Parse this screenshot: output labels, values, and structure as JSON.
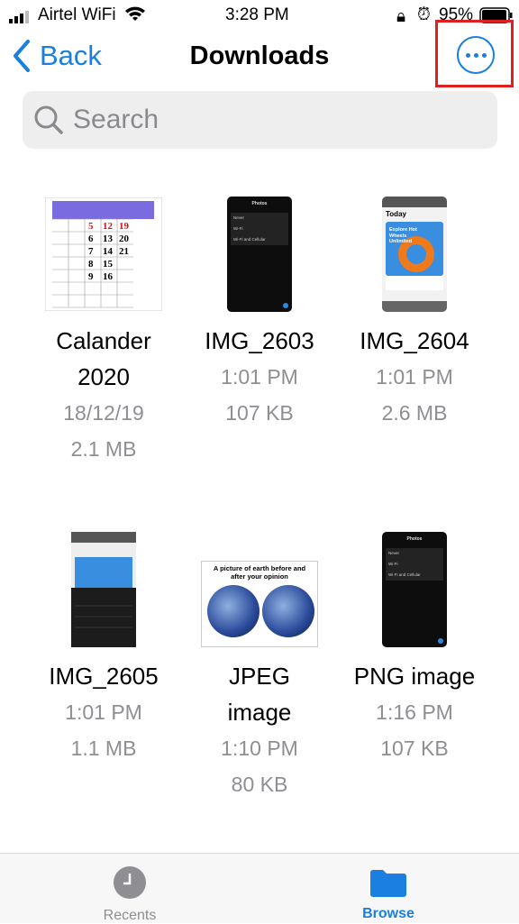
{
  "status": {
    "carrier": "Airtel WiFi",
    "time": "3:28 PM",
    "battery": "95%"
  },
  "nav": {
    "back": "Back",
    "title": "Downloads",
    "more_icon": "ellipsis-circle-icon"
  },
  "search": {
    "placeholder": "Search"
  },
  "files": [
    {
      "name1": "Calander",
      "name2": "2020",
      "meta1": "18/12/19",
      "meta2": "2.1 MB",
      "thumb": "calendar"
    },
    {
      "name1": "IMG_2603",
      "name2": "",
      "meta1": "1:01 PM",
      "meta2": "107 KB",
      "thumb": "dark-phone"
    },
    {
      "name1": "IMG_2604",
      "name2": "",
      "meta1": "1:01 PM",
      "meta2": "2.6 MB",
      "thumb": "app-store"
    },
    {
      "name1": "IMG_2605",
      "name2": "",
      "meta1": "1:01 PM",
      "meta2": "1.1 MB",
      "thumb": "app-store-share"
    },
    {
      "name1": "JPEG",
      "name2": "image",
      "meta1": "1:10 PM",
      "meta2": "80 KB",
      "thumb": "earth"
    },
    {
      "name1": "PNG image",
      "name2": "",
      "meta1": "1:16 PM",
      "meta2": "107 KB",
      "thumb": "dark-phone"
    }
  ],
  "thumbs": {
    "earth_caption": "A picture of earth before and after your opinion",
    "today": "Today",
    "explore": "Explore Hot Wheels Unlimited",
    "photos": "Photos",
    "never": "Never",
    "wifi": "Wi-Fi",
    "wifi_cell": "Wi-Fi and Cellular"
  },
  "tabbar": {
    "recents": "Recents",
    "browse": "Browse",
    "accent": "#1a7fe0"
  }
}
